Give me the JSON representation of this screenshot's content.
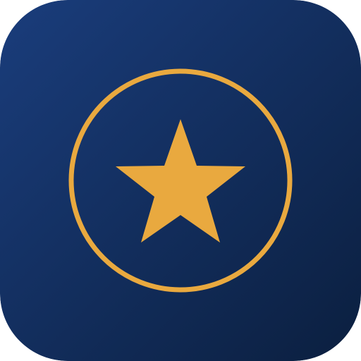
{
  "app_icon": {
    "icon": "star-in-circle-icon",
    "colors": {
      "background_top": "#1a3d7c",
      "background_bottom": "#0b1f3f",
      "ring": "#e9a93f",
      "star": "#e9a93f"
    }
  }
}
